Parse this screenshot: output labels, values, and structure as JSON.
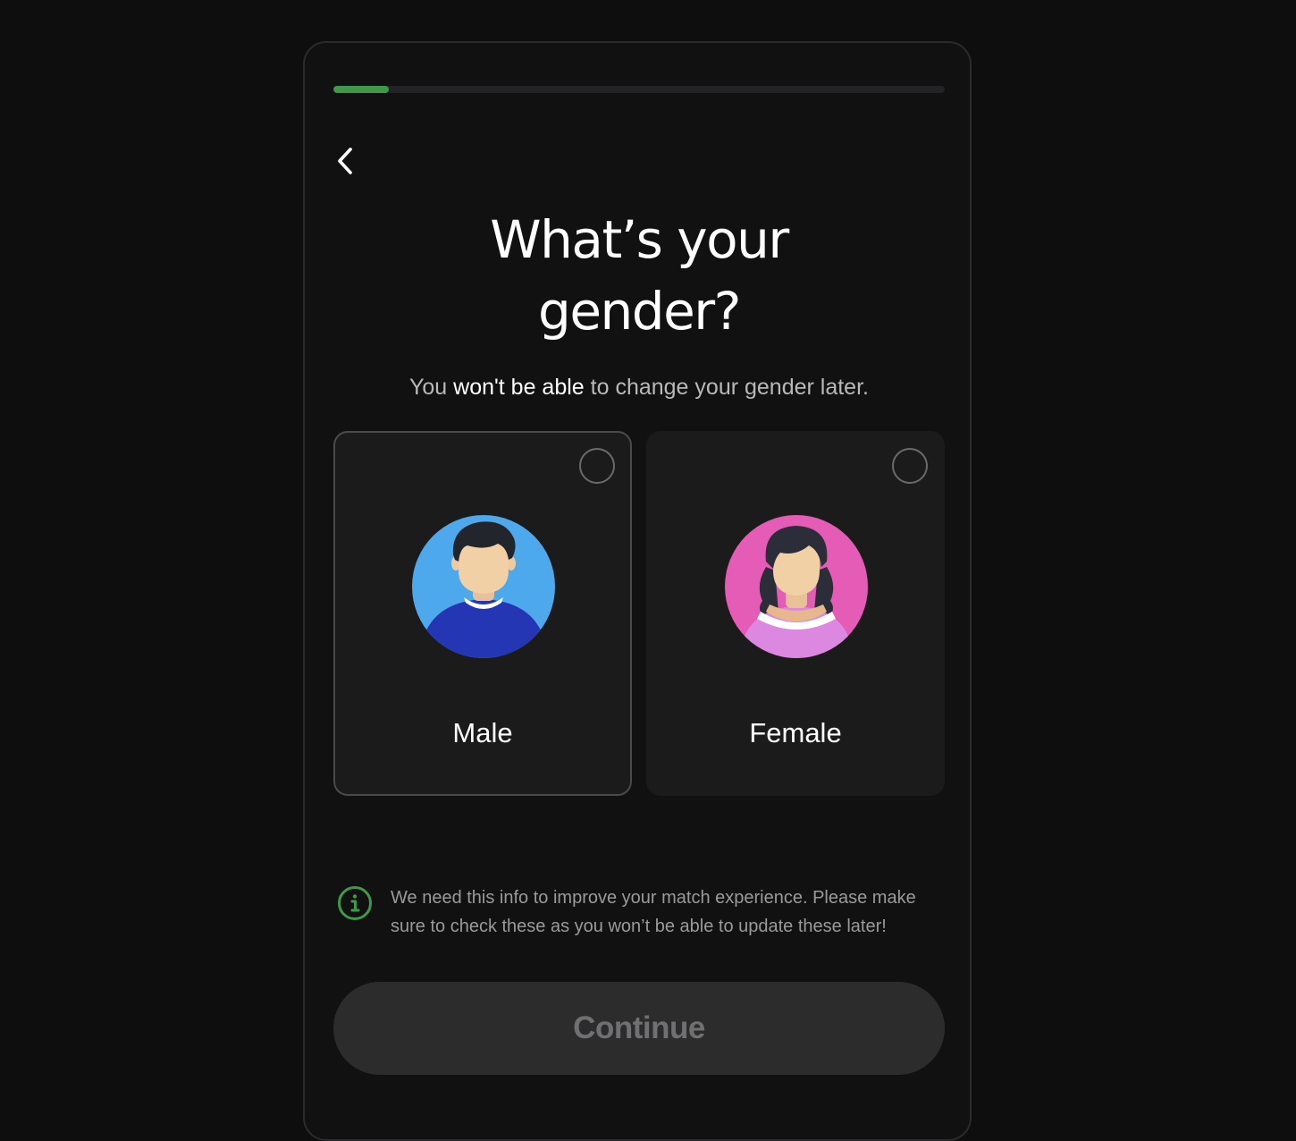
{
  "onboarding": {
    "progress_percent": 9,
    "accent_color": "#3e9a4a",
    "back_icon": "chevron-left-icon",
    "title_line1": "What’s your",
    "title_line2": "gender?",
    "subtitle": {
      "before": "You ",
      "emphasis": "won't be able",
      "after": " to change your gender later."
    },
    "options": [
      {
        "label": "Male",
        "avatar": "male-avatar-icon",
        "selected": false
      },
      {
        "label": "Female",
        "avatar": "female-avatar-icon",
        "selected": false
      }
    ],
    "info": {
      "icon": "info-icon",
      "text": "We need this info to improve your match experience. Please make sure to check these as you won’t be able to update these later!"
    },
    "continue_label": "Continue"
  }
}
